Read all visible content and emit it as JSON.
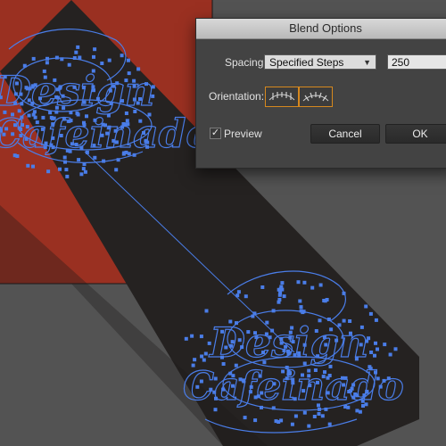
{
  "canvas": {
    "artboard_color": "#9a3021",
    "blend_color": "#252221",
    "selection_color": "#4a7de8",
    "artwork_text_line1": "Design",
    "artwork_text_line2": "Cafeinado"
  },
  "dialog": {
    "title": "Blend Options",
    "spacing_label": "Spacing:",
    "spacing_value": "Specified Steps",
    "steps_value": "250",
    "orientation_label": "Orientation:",
    "orientation_options": [
      "align-to-page-icon",
      "align-to-path-icon"
    ],
    "preview_label": "Preview",
    "preview_checked": true,
    "cancel_label": "Cancel",
    "ok_label": "OK"
  }
}
